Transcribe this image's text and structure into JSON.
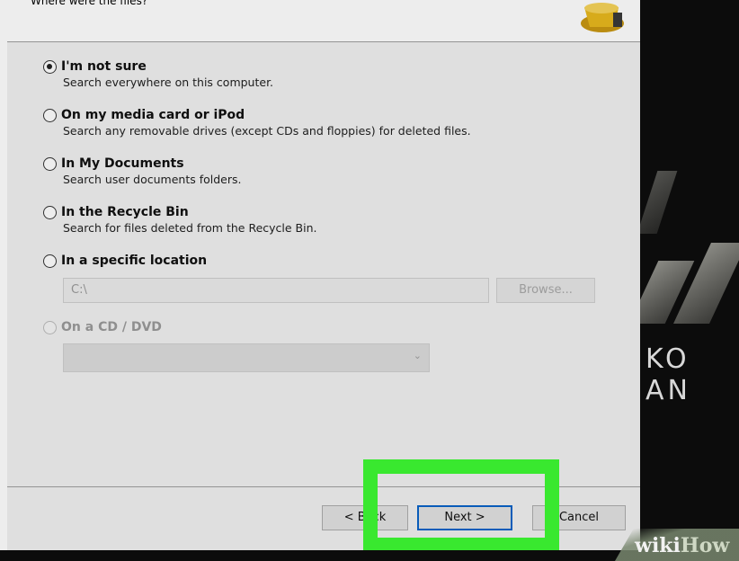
{
  "header": {
    "partial_text": "Where were the files?",
    "icon": "recycle-bin-icon"
  },
  "options": [
    {
      "title": "I'm not sure",
      "desc": "Search everywhere on this computer.",
      "checked": true
    },
    {
      "title": "On my media card or iPod",
      "desc": "Search any removable drives (except CDs and floppies) for deleted files.",
      "checked": false
    },
    {
      "title": "In My Documents",
      "desc": "Search user documents folders.",
      "checked": false
    },
    {
      "title": "In the Recycle Bin",
      "desc": "Search for files deleted from the Recycle Bin.",
      "checked": false
    },
    {
      "title": "In a specific location",
      "checked": false
    }
  ],
  "specific_location": {
    "path_value": "C:\\",
    "browse_label": "Browse..."
  },
  "cd_option": {
    "title": "On a CD / DVD",
    "disabled": true
  },
  "footer": {
    "back_label": "< Back",
    "next_label": "Next >",
    "cancel_label": "Cancel"
  },
  "backdrop": {
    "logo_text": "KO AN"
  },
  "watermark": {
    "wiki": "wiki",
    "how": "How"
  },
  "colors": {
    "highlight": "#39e82f",
    "next_border": "#0a64c8"
  }
}
